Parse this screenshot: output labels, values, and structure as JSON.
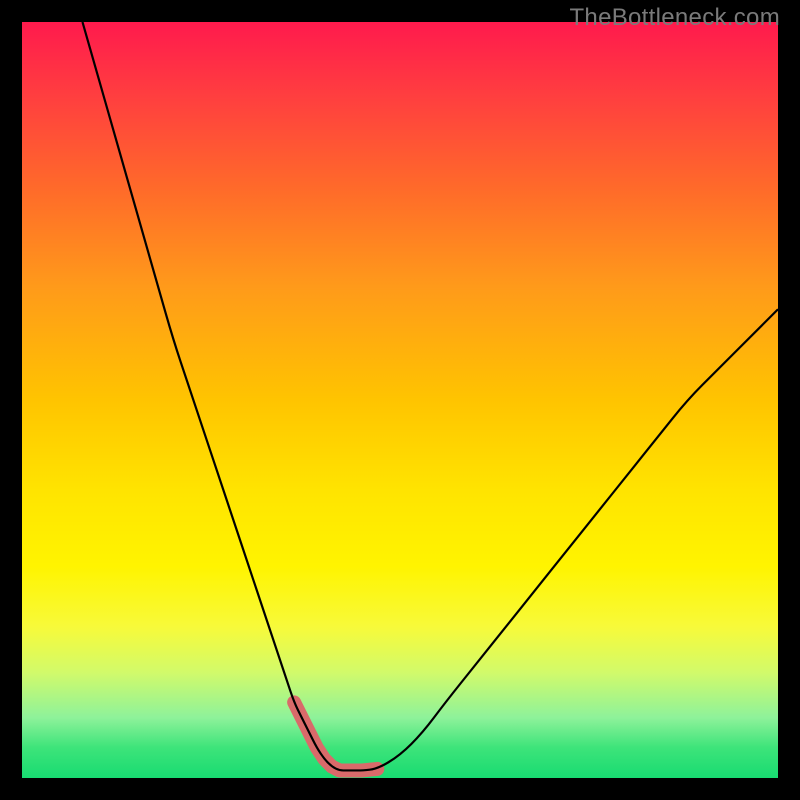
{
  "watermark": "TheBottleneck.com",
  "chart_data": {
    "type": "line",
    "title": "",
    "xlabel": "",
    "ylabel": "",
    "xlim": [
      0,
      100
    ],
    "ylim": [
      0,
      100
    ],
    "grid": false,
    "legend": false,
    "series": [
      {
        "name": "curve",
        "x": [
          8,
          10,
          12,
          14,
          16,
          18,
          20,
          22,
          24,
          26,
          28,
          30,
          32,
          34,
          35,
          36,
          37,
          38,
          39,
          40,
          41,
          42,
          43,
          44,
          45,
          47,
          50,
          53,
          56,
          60,
          64,
          68,
          72,
          76,
          80,
          84,
          88,
          92,
          96,
          100
        ],
        "y": [
          100,
          93,
          86,
          79,
          72,
          65,
          58,
          52,
          46,
          40,
          34,
          28,
          22,
          16,
          13,
          10,
          8,
          6,
          4,
          2.5,
          1.5,
          1.0,
          1.0,
          1.0,
          1.0,
          1.2,
          3,
          6,
          10,
          15,
          20,
          25,
          30,
          35,
          40,
          45,
          50,
          54,
          58,
          62
        ]
      }
    ],
    "highlight": {
      "name": "bottom-region",
      "x_range": [
        35.5,
        47
      ],
      "y_approx": 1.5
    },
    "colors": {
      "gradient_top": "#ff1a4d",
      "gradient_mid": "#ffe400",
      "gradient_bottom": "#18db71",
      "curve": "#000000",
      "highlight": "#d96a6a",
      "background": "#000000"
    }
  }
}
